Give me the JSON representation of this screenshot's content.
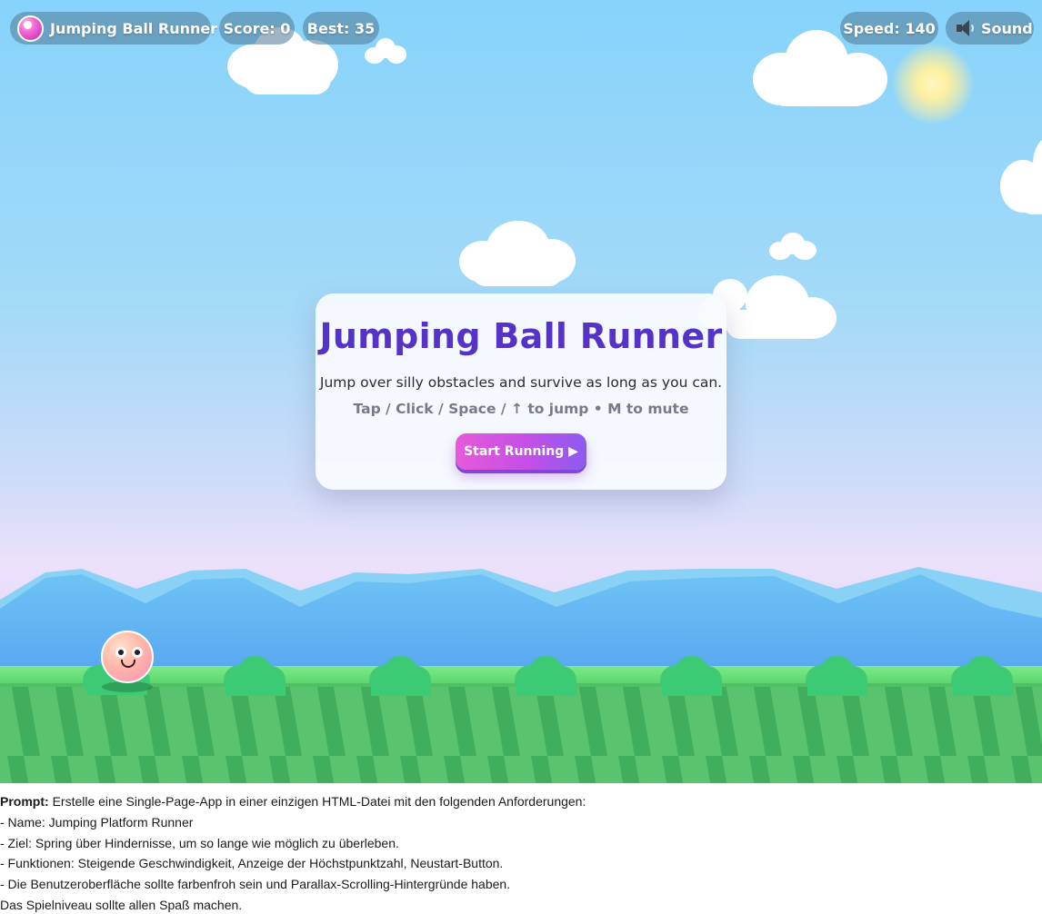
{
  "hud": {
    "title": "Jumping Ball Runner",
    "score": "Score: 0",
    "best": "Best: 35",
    "speed": "Speed: 140",
    "sound": "Sound"
  },
  "dialog": {
    "title": "Jumping Ball Runner",
    "subtitle": "Jump over silly obstacles and survive as long as you can.",
    "controls": "Tap / Click / Space / ↑ to jump • M to mute",
    "start_button": "Start Running ▶"
  },
  "prompt": {
    "label": "Prompt:",
    "first_line": "Erstelle eine Single-Page-App in einer einzigen HTML-Datei mit den folgenden Anforderungen:",
    "lines": [
      "- Name: Jumping Platform Runner",
      "- Ziel: Spring über Hindernisse, um so lange wie möglich zu überleben.",
      "- Funktionen: Steigende Geschwindigkeit, Anzeige der Höchstpunktzahl, Neustart-Button.",
      "- Die Benutzeroberfläche sollte farbenfroh sein und Parallax-Scrolling-Hintergründe haben.",
      "Das Spielniveau sollte allen Spaß machen."
    ]
  },
  "icons": {
    "logo": "ball-logo-icon",
    "sound": "speaker-icon"
  },
  "colors": {
    "title_purple": "#5533c8",
    "button_pink": "#e65ad8",
    "button_violet": "#8a5cf0",
    "grass": "#5cc46e",
    "sky": "#86d3fb"
  }
}
